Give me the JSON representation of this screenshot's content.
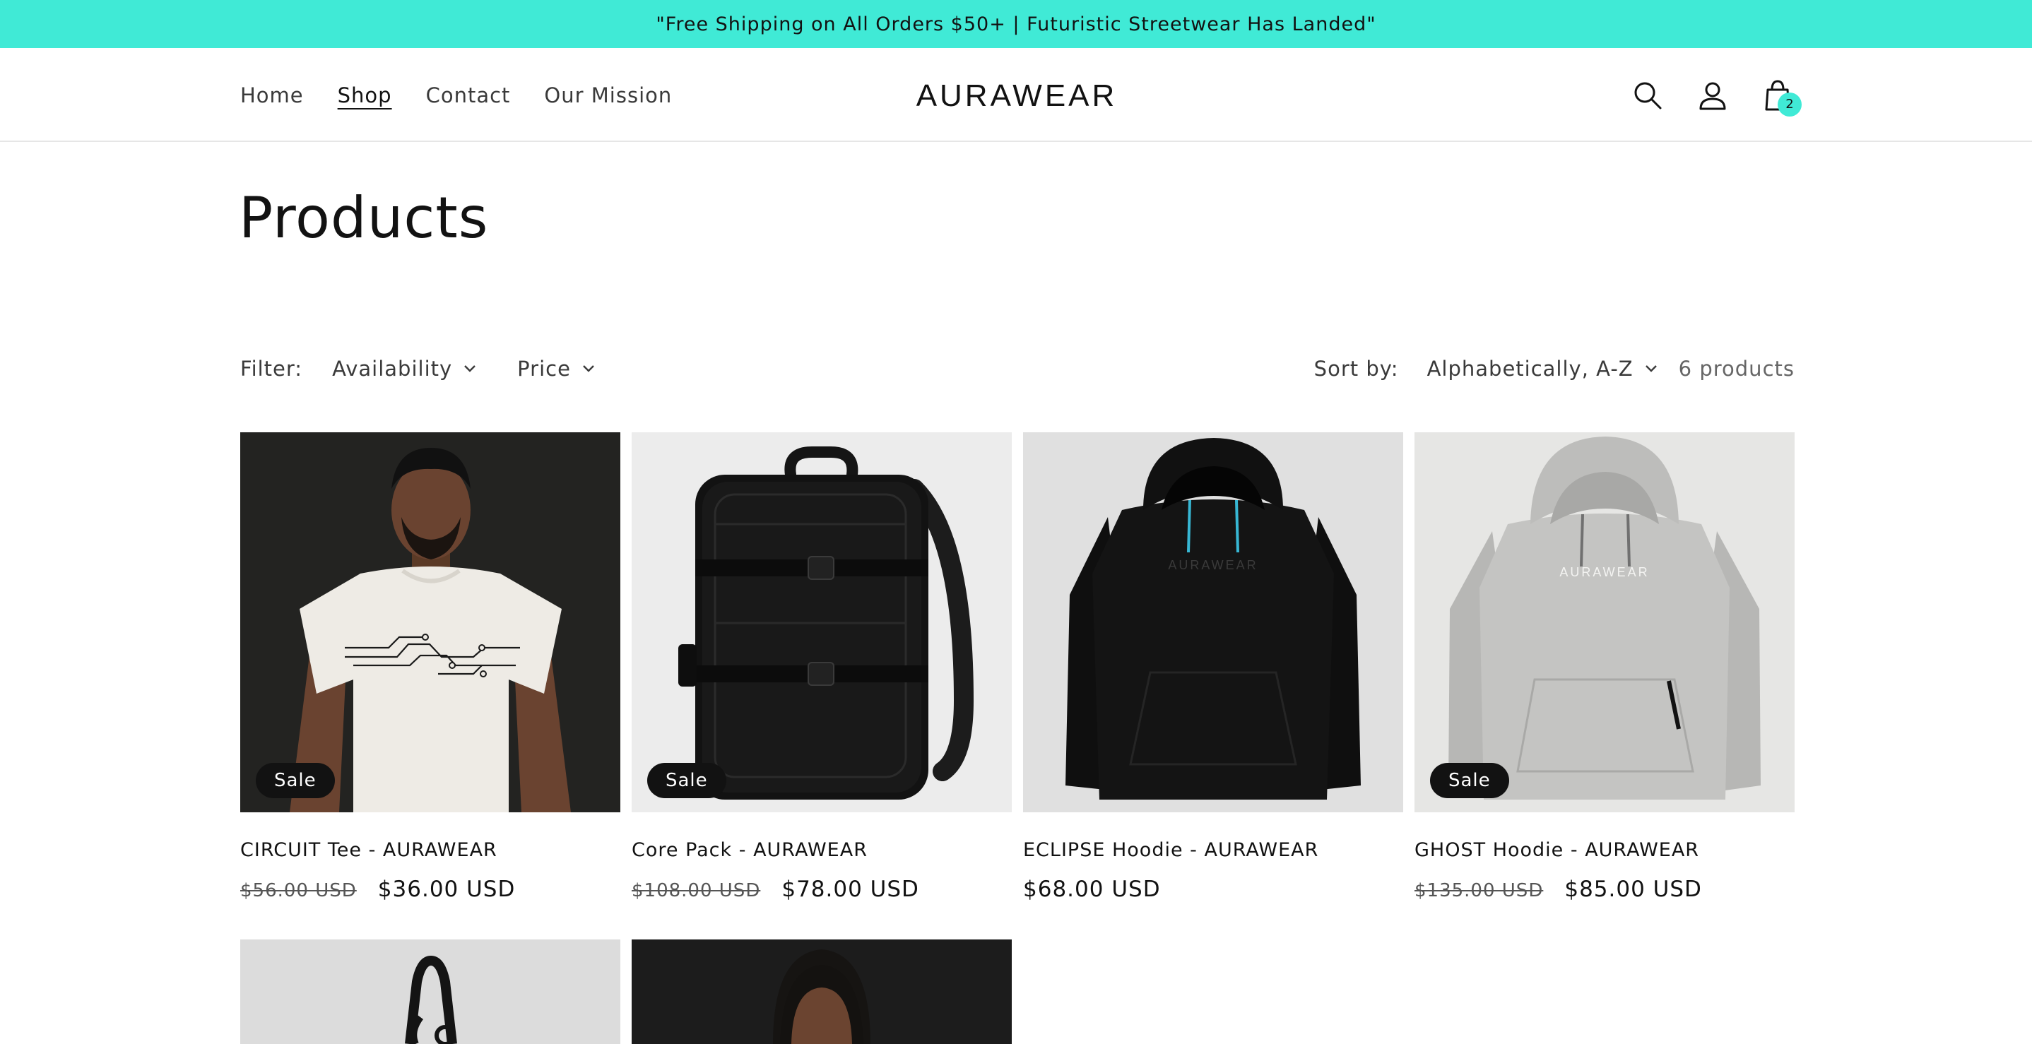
{
  "announcement": "\"Free Shipping on All Orders $50+ | Futuristic Streetwear Has Landed\"",
  "brand": "AURAWEAR",
  "nav": [
    "Home",
    "Shop",
    "Contact",
    "Our Mission"
  ],
  "nav_active": "Shop",
  "header_icons": [
    "search-icon",
    "account-icon",
    "cart-icon"
  ],
  "cart_count": "2",
  "page_title": "Products",
  "filter": {
    "label": "Filter:",
    "availability": "Availability",
    "price": "Price"
  },
  "sort": {
    "label": "Sort by:",
    "value": "Alphabetically, A-Z"
  },
  "product_count": "6 products",
  "products": [
    {
      "title": "CIRCUIT Tee - AURAWEAR",
      "old_price": "$56.00 USD",
      "price": "$36.00 USD",
      "badge": "Sale"
    },
    {
      "title": "Core Pack - AURAWEAR",
      "old_price": "$108.00 USD",
      "price": "$78.00 USD",
      "badge": "Sale"
    },
    {
      "title": "ECLIPSE Hoodie - AURAWEAR",
      "old_price": "",
      "price": "$68.00 USD",
      "badge": ""
    },
    {
      "title": "GHOST Hoodie - AURAWEAR",
      "old_price": "$135.00 USD",
      "price": "$85.00 USD",
      "badge": "Sale"
    }
  ],
  "hoodie_prints": [
    "AURAWEAR",
    "AURAWEAR"
  ],
  "colors": {
    "accent": "#40ead6",
    "text": "#121212",
    "badge_bg": "#121212"
  }
}
